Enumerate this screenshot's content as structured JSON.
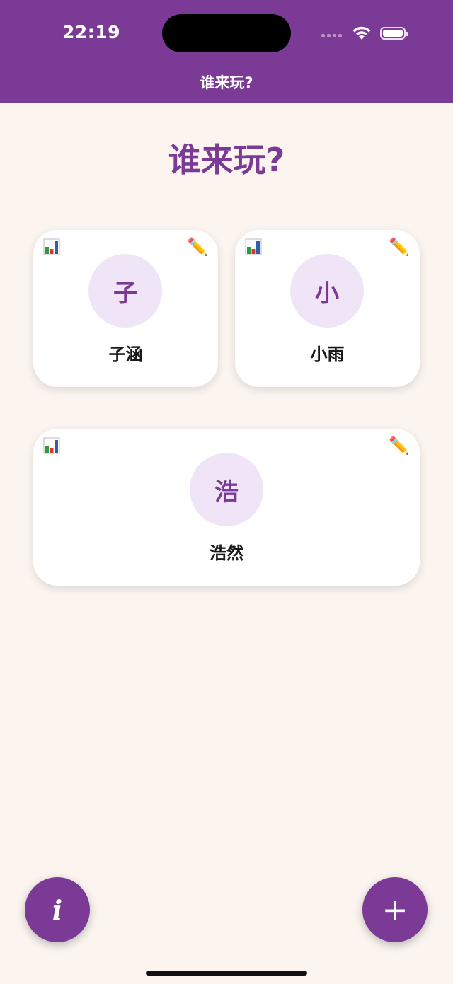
{
  "status_bar": {
    "time": "22:19"
  },
  "nav": {
    "title": "谁来玩?"
  },
  "heading": "谁来玩?",
  "players": [
    {
      "initial": "子",
      "name": "子涵"
    },
    {
      "initial": "小",
      "name": "小雨"
    },
    {
      "initial": "浩",
      "name": "浩然"
    }
  ],
  "icons": {
    "stats": "bar-chart-icon",
    "edit": "pencil-icon",
    "info": "i",
    "add": "+"
  },
  "colors": {
    "accent": "#7b3a96",
    "background": "#fbf4ef",
    "avatar_bg": "#efe5f6"
  }
}
